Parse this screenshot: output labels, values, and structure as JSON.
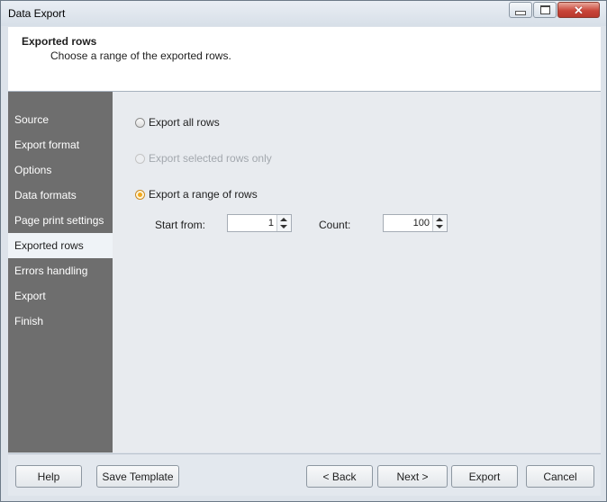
{
  "window": {
    "title": "Data Export"
  },
  "header": {
    "title": "Exported rows",
    "subtitle": "Choose a range of the exported rows."
  },
  "sidebar": {
    "items": [
      {
        "label": "Source"
      },
      {
        "label": "Export format"
      },
      {
        "label": "Options"
      },
      {
        "label": "Data formats"
      },
      {
        "label": "Page print settings"
      },
      {
        "label": "Exported rows",
        "active": true
      },
      {
        "label": "Errors handling"
      },
      {
        "label": "Export"
      },
      {
        "label": "Finish"
      }
    ]
  },
  "options": {
    "export_all": {
      "label": "Export all rows",
      "checked": false,
      "enabled": true
    },
    "export_selected": {
      "label": "Export selected rows only",
      "checked": false,
      "enabled": false
    },
    "export_range": {
      "label": "Export a range of rows",
      "checked": true,
      "enabled": true
    }
  },
  "range": {
    "start_label": "Start from:",
    "start_value": "1",
    "count_label": "Count:",
    "count_value": "100"
  },
  "footer": {
    "help": "Help",
    "save_template": "Save Template",
    "back": "< Back",
    "next": "Next >",
    "export": "Export",
    "cancel": "Cancel"
  },
  "colors": {
    "sidebar_bg": "#6e6e6e",
    "active_item_bg": "#eff3f7",
    "radio_checked": "#f2a81c"
  }
}
